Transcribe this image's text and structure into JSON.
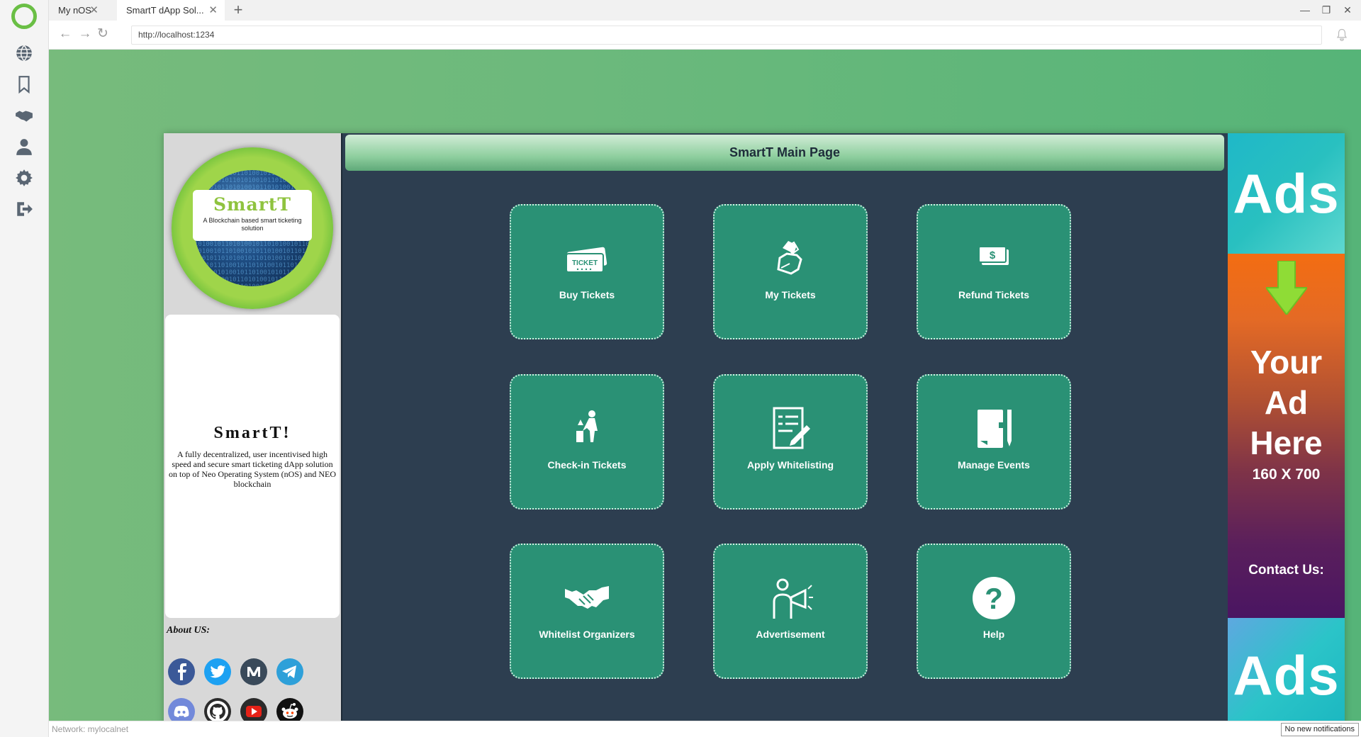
{
  "browser": {
    "tabs": [
      {
        "label": "My nOS"
      },
      {
        "label": "SmartT dApp Sol..."
      }
    ],
    "url": "http://localhost:1234",
    "network": "Network: mylocalnet",
    "notifications": "No new notifications"
  },
  "sidebar": {
    "icons": [
      "globe-icon",
      "bookmark-icon",
      "handshake-icon",
      "user-icon",
      "gear-icon",
      "logout-icon"
    ]
  },
  "logo": {
    "title": "SmartT",
    "subtitle": "A Blockchain based smart ticketing solution"
  },
  "about": {
    "title": "SmartT!",
    "description": "A fully decentralized, user incentivised high speed and secure smart ticketing dApp solution on top of Neo Operating System (nOS) and NEO blockchain",
    "about_label": "About US:",
    "social": [
      "facebook-icon",
      "twitter-icon",
      "medium-icon",
      "telegram-icon",
      "discord-icon",
      "github-icon",
      "youtube-icon",
      "reddit-icon"
    ]
  },
  "main": {
    "title": "SmartT Main Page",
    "tiles": [
      {
        "label": "Buy Tickets",
        "icon": "ticket-icon"
      },
      {
        "label": "My Tickets",
        "icon": "hand-tickets-icon"
      },
      {
        "label": "Refund Tickets",
        "icon": "money-icon"
      },
      {
        "label": "Check-in Tickets",
        "icon": "checkin-person-icon"
      },
      {
        "label": "Apply Whitelisting",
        "icon": "form-edit-icon"
      },
      {
        "label": "Manage Events",
        "icon": "notebook-pencil-icon"
      },
      {
        "label": "Whitelist Organizers",
        "icon": "handshake-icon"
      },
      {
        "label": "Advertisement",
        "icon": "megaphone-person-icon"
      },
      {
        "label": "Help",
        "icon": "question-icon"
      }
    ]
  },
  "ads": {
    "top": "Ads",
    "headline": [
      "Your",
      "Ad",
      "Here"
    ],
    "size": "160 X 700",
    "contact": "Contact Us:",
    "bottom": "Ads"
  },
  "colors": {
    "tile": "#2a9175",
    "main_bg": "#2d3e50",
    "brand_green": "#6abf45"
  }
}
